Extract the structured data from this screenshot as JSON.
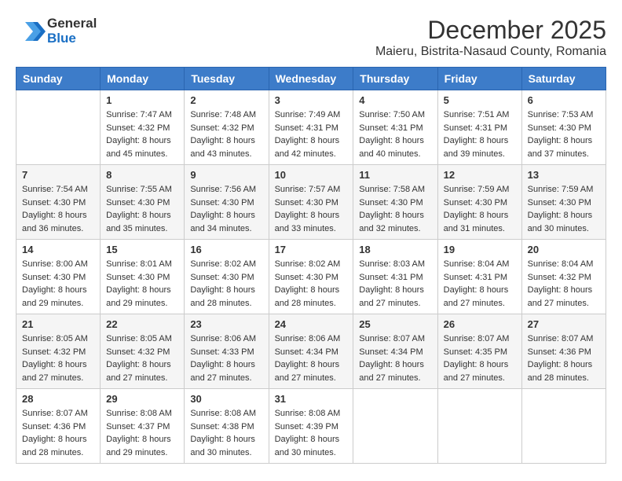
{
  "header": {
    "logo": {
      "general": "General",
      "blue": "Blue"
    },
    "title": "December 2025",
    "location": "Maieru, Bistrita-Nasaud County, Romania"
  },
  "weekdays": [
    "Sunday",
    "Monday",
    "Tuesday",
    "Wednesday",
    "Thursday",
    "Friday",
    "Saturday"
  ],
  "weeks": [
    [
      {
        "day": "",
        "info": ""
      },
      {
        "day": "1",
        "info": "Sunrise: 7:47 AM\nSunset: 4:32 PM\nDaylight: 8 hours\nand 45 minutes."
      },
      {
        "day": "2",
        "info": "Sunrise: 7:48 AM\nSunset: 4:32 PM\nDaylight: 8 hours\nand 43 minutes."
      },
      {
        "day": "3",
        "info": "Sunrise: 7:49 AM\nSunset: 4:31 PM\nDaylight: 8 hours\nand 42 minutes."
      },
      {
        "day": "4",
        "info": "Sunrise: 7:50 AM\nSunset: 4:31 PM\nDaylight: 8 hours\nand 40 minutes."
      },
      {
        "day": "5",
        "info": "Sunrise: 7:51 AM\nSunset: 4:31 PM\nDaylight: 8 hours\nand 39 minutes."
      },
      {
        "day": "6",
        "info": "Sunrise: 7:53 AM\nSunset: 4:30 PM\nDaylight: 8 hours\nand 37 minutes."
      }
    ],
    [
      {
        "day": "7",
        "info": "Sunrise: 7:54 AM\nSunset: 4:30 PM\nDaylight: 8 hours\nand 36 minutes."
      },
      {
        "day": "8",
        "info": "Sunrise: 7:55 AM\nSunset: 4:30 PM\nDaylight: 8 hours\nand 35 minutes."
      },
      {
        "day": "9",
        "info": "Sunrise: 7:56 AM\nSunset: 4:30 PM\nDaylight: 8 hours\nand 34 minutes."
      },
      {
        "day": "10",
        "info": "Sunrise: 7:57 AM\nSunset: 4:30 PM\nDaylight: 8 hours\nand 33 minutes."
      },
      {
        "day": "11",
        "info": "Sunrise: 7:58 AM\nSunset: 4:30 PM\nDaylight: 8 hours\nand 32 minutes."
      },
      {
        "day": "12",
        "info": "Sunrise: 7:59 AM\nSunset: 4:30 PM\nDaylight: 8 hours\nand 31 minutes."
      },
      {
        "day": "13",
        "info": "Sunrise: 7:59 AM\nSunset: 4:30 PM\nDaylight: 8 hours\nand 30 minutes."
      }
    ],
    [
      {
        "day": "14",
        "info": "Sunrise: 8:00 AM\nSunset: 4:30 PM\nDaylight: 8 hours\nand 29 minutes."
      },
      {
        "day": "15",
        "info": "Sunrise: 8:01 AM\nSunset: 4:30 PM\nDaylight: 8 hours\nand 29 minutes."
      },
      {
        "day": "16",
        "info": "Sunrise: 8:02 AM\nSunset: 4:30 PM\nDaylight: 8 hours\nand 28 minutes."
      },
      {
        "day": "17",
        "info": "Sunrise: 8:02 AM\nSunset: 4:30 PM\nDaylight: 8 hours\nand 28 minutes."
      },
      {
        "day": "18",
        "info": "Sunrise: 8:03 AM\nSunset: 4:31 PM\nDaylight: 8 hours\nand 27 minutes."
      },
      {
        "day": "19",
        "info": "Sunrise: 8:04 AM\nSunset: 4:31 PM\nDaylight: 8 hours\nand 27 minutes."
      },
      {
        "day": "20",
        "info": "Sunrise: 8:04 AM\nSunset: 4:32 PM\nDaylight: 8 hours\nand 27 minutes."
      }
    ],
    [
      {
        "day": "21",
        "info": "Sunrise: 8:05 AM\nSunset: 4:32 PM\nDaylight: 8 hours\nand 27 minutes."
      },
      {
        "day": "22",
        "info": "Sunrise: 8:05 AM\nSunset: 4:32 PM\nDaylight: 8 hours\nand 27 minutes."
      },
      {
        "day": "23",
        "info": "Sunrise: 8:06 AM\nSunset: 4:33 PM\nDaylight: 8 hours\nand 27 minutes."
      },
      {
        "day": "24",
        "info": "Sunrise: 8:06 AM\nSunset: 4:34 PM\nDaylight: 8 hours\nand 27 minutes."
      },
      {
        "day": "25",
        "info": "Sunrise: 8:07 AM\nSunset: 4:34 PM\nDaylight: 8 hours\nand 27 minutes."
      },
      {
        "day": "26",
        "info": "Sunrise: 8:07 AM\nSunset: 4:35 PM\nDaylight: 8 hours\nand 27 minutes."
      },
      {
        "day": "27",
        "info": "Sunrise: 8:07 AM\nSunset: 4:36 PM\nDaylight: 8 hours\nand 28 minutes."
      }
    ],
    [
      {
        "day": "28",
        "info": "Sunrise: 8:07 AM\nSunset: 4:36 PM\nDaylight: 8 hours\nand 28 minutes."
      },
      {
        "day": "29",
        "info": "Sunrise: 8:08 AM\nSunset: 4:37 PM\nDaylight: 8 hours\nand 29 minutes."
      },
      {
        "day": "30",
        "info": "Sunrise: 8:08 AM\nSunset: 4:38 PM\nDaylight: 8 hours\nand 30 minutes."
      },
      {
        "day": "31",
        "info": "Sunrise: 8:08 AM\nSunset: 4:39 PM\nDaylight: 8 hours\nand 30 minutes."
      },
      {
        "day": "",
        "info": ""
      },
      {
        "day": "",
        "info": ""
      },
      {
        "day": "",
        "info": ""
      }
    ]
  ]
}
